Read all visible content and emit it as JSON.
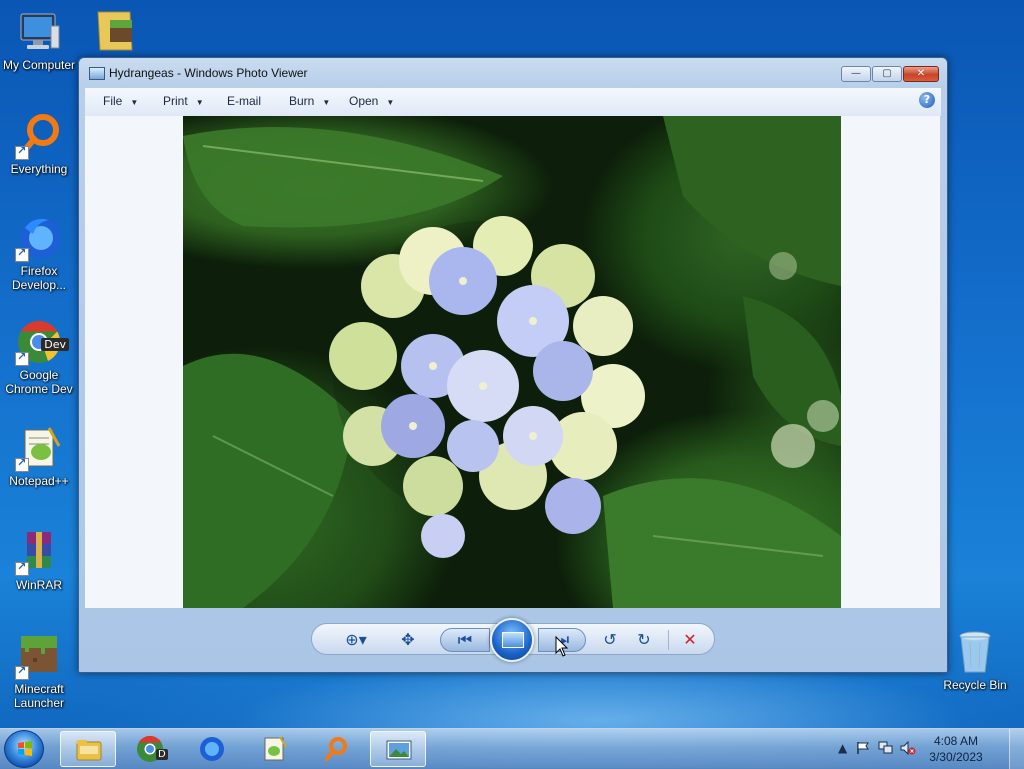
{
  "desktop": {
    "icons": [
      {
        "label": "My Computer"
      },
      {
        "label": ""
      },
      {
        "label": "Everything"
      },
      {
        "label": "Firefox Develop..."
      },
      {
        "label": "Google Chrome Dev"
      },
      {
        "label": "Notepad++"
      },
      {
        "label": "WinRAR"
      },
      {
        "label": "Minecraft Launcher"
      },
      {
        "label": "Recycle Bin"
      }
    ],
    "chrome_badge": "Dev"
  },
  "window": {
    "title": "Hydrangeas - Windows Photo Viewer",
    "controls": {
      "minimize": "—",
      "maximize": "▢",
      "close": "✕"
    },
    "menu": {
      "file": "File",
      "print": "Print",
      "email": "E-mail",
      "burn": "Burn",
      "open": "Open",
      "dropdown_arrow": "▼",
      "help": "?"
    },
    "toolbar": {
      "zoom": "⊕▾",
      "fit": "✥",
      "prev": "⏮",
      "next": "⏭",
      "rotate_left": "↺",
      "rotate_right": "↻",
      "delete": "✕"
    }
  },
  "taskbar": {
    "chrome_badge": "D",
    "clock_time": "4:08 AM",
    "clock_date": "3/30/2023",
    "tray": {
      "expand": "▲"
    }
  },
  "colors": {
    "desktop_blue": "#1470cc",
    "close_red": "#c8432a",
    "accent": "#1b63c8"
  }
}
